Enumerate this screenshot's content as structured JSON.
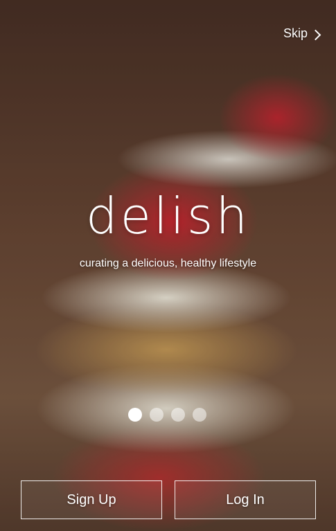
{
  "skip": {
    "label": "Skip",
    "icon": "chevron-right-icon"
  },
  "logo": "delish",
  "tagline": "curating a delicious, healthy lifestyle",
  "carousel": {
    "page_count": 4,
    "active_index": 0
  },
  "buttons": {
    "sign_up": "Sign Up",
    "log_in": "Log In"
  },
  "colors": {
    "text": "#ffffff",
    "dot_active": "#ffffff"
  }
}
